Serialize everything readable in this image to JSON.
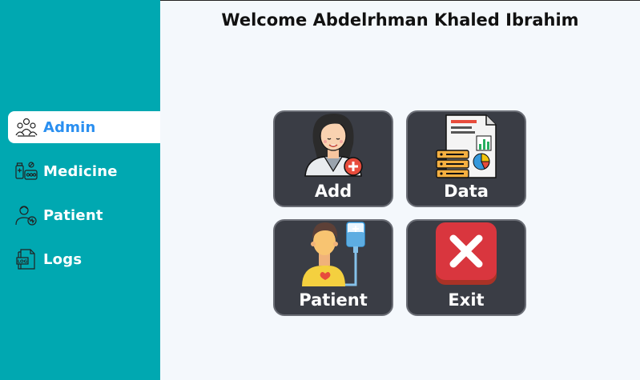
{
  "welcome": "Welcome Abdelrhman Khaled Ibrahim",
  "sidebar": {
    "items": [
      {
        "label": "Admin",
        "icon": "admin-group-icon",
        "active": true
      },
      {
        "label": "Medicine",
        "icon": "medicine-icon",
        "active": false
      },
      {
        "label": "Patient",
        "icon": "patient-icon",
        "active": false
      },
      {
        "label": "Logs",
        "icon": "logs-icon",
        "active": false
      }
    ]
  },
  "tiles": {
    "add": {
      "label": "Add",
      "icon": "doctor-add-icon"
    },
    "data": {
      "label": "Data",
      "icon": "data-report-icon"
    },
    "patient": {
      "label": "Patient",
      "icon": "patient-iv-icon"
    },
    "exit": {
      "label": "Exit",
      "icon": "exit-x-icon"
    }
  },
  "colors": {
    "sidebar": "#00a8b1",
    "active_text": "#2a8ff0",
    "tile_bg": "#3a3d45",
    "page_bg": "#f4f8fc",
    "exit_red": "#d9363e"
  }
}
